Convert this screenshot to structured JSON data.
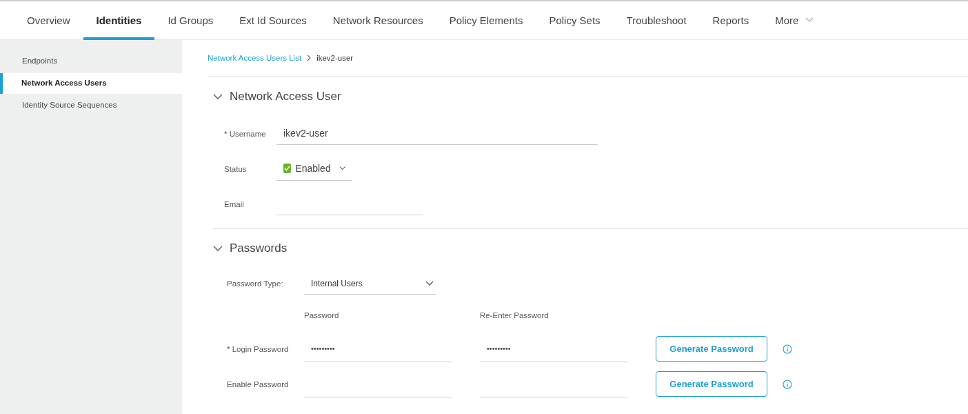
{
  "tabs": [
    {
      "label": "Overview",
      "selected": false
    },
    {
      "label": "Identities",
      "selected": true
    },
    {
      "label": "Id Groups",
      "selected": false
    },
    {
      "label": "Ext Id Sources",
      "selected": false
    },
    {
      "label": "Network Resources",
      "selected": false
    },
    {
      "label": "Policy Elements",
      "selected": false
    },
    {
      "label": "Policy Sets",
      "selected": false
    },
    {
      "label": "Troubleshoot",
      "selected": false
    },
    {
      "label": "Reports",
      "selected": false
    },
    {
      "label": "More",
      "selected": false,
      "kind": "menu"
    }
  ],
  "sidebar": {
    "items": [
      {
        "label": "Endpoints",
        "selected": false
      },
      {
        "label": "Network Access Users",
        "selected": true
      },
      {
        "label": "Identity Source Sequences",
        "selected": false
      }
    ]
  },
  "breadcrumb": {
    "link": "Network Access Users List",
    "current": "ikev2-user"
  },
  "user_section": {
    "title": "Network Access User",
    "expanded": true,
    "username": {
      "label": "* Username",
      "value": "ikev2-user"
    },
    "status": {
      "label": "Status",
      "value": "Enabled",
      "checked": true
    },
    "email": {
      "label": "Email"
    }
  },
  "passwords_section": {
    "title": "Passwords",
    "expanded": true,
    "password_type": {
      "label": "Password Type:",
      "value": "Internal Users"
    },
    "column_headers": [
      "Password",
      "Re-Enter Password"
    ],
    "rows": [
      {
        "label": "* Login Password",
        "password": "•••••••••",
        "reenter": "•••••••••",
        "button": "Generate Password"
      },
      {
        "label": "Enable Password",
        "button": "Generate Password"
      }
    ]
  }
}
